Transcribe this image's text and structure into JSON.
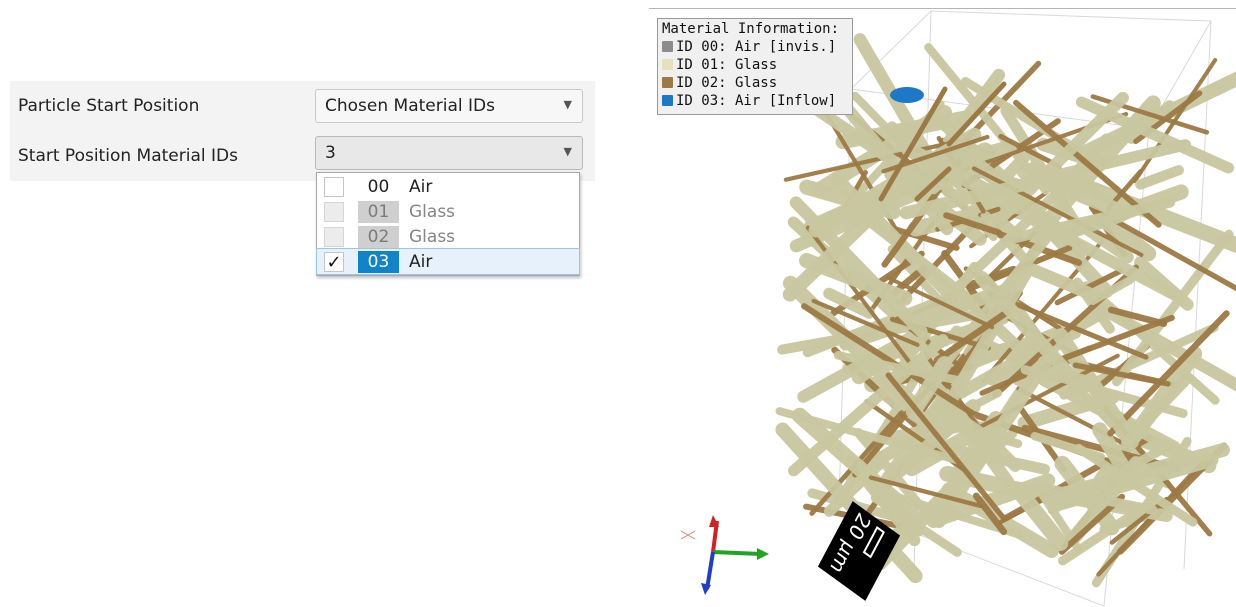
{
  "settings": {
    "start_position": {
      "label": "Particle Start Position",
      "value": "Chosen Material IDs"
    },
    "start_material_ids": {
      "label": "Start Position Material IDs",
      "value": "3"
    }
  },
  "dropdown": {
    "items": [
      {
        "id": "00",
        "name": "Air",
        "checked": false,
        "enabled": true,
        "selected": false
      },
      {
        "id": "01",
        "name": "Glass",
        "checked": false,
        "enabled": false,
        "selected": false
      },
      {
        "id": "02",
        "name": "Glass",
        "checked": false,
        "enabled": false,
        "selected": false
      },
      {
        "id": "03",
        "name": "Air",
        "checked": true,
        "enabled": true,
        "selected": true,
        "check_mark": "✓"
      }
    ]
  },
  "legend": {
    "title": "Material Information:",
    "items": [
      {
        "text": "ID 00: Air [invis.]",
        "color": "#8c8c8c"
      },
      {
        "text": "ID 01: Glass",
        "color": "#e6e0bf"
      },
      {
        "text": "ID 02: Glass",
        "color": "#9c7a45"
      },
      {
        "text": "ID 03: Air [Inflow]",
        "color": "#1e78c8"
      }
    ]
  },
  "scale_bar": {
    "label": "20 µm"
  },
  "colors": {
    "fiber_light": "#c9c7a0",
    "fiber_dark": "#9c7a45",
    "accent": "#1183c8",
    "axis_x": "#d62020",
    "axis_y": "#1fa51f",
    "axis_z": "#1f3ec8"
  }
}
